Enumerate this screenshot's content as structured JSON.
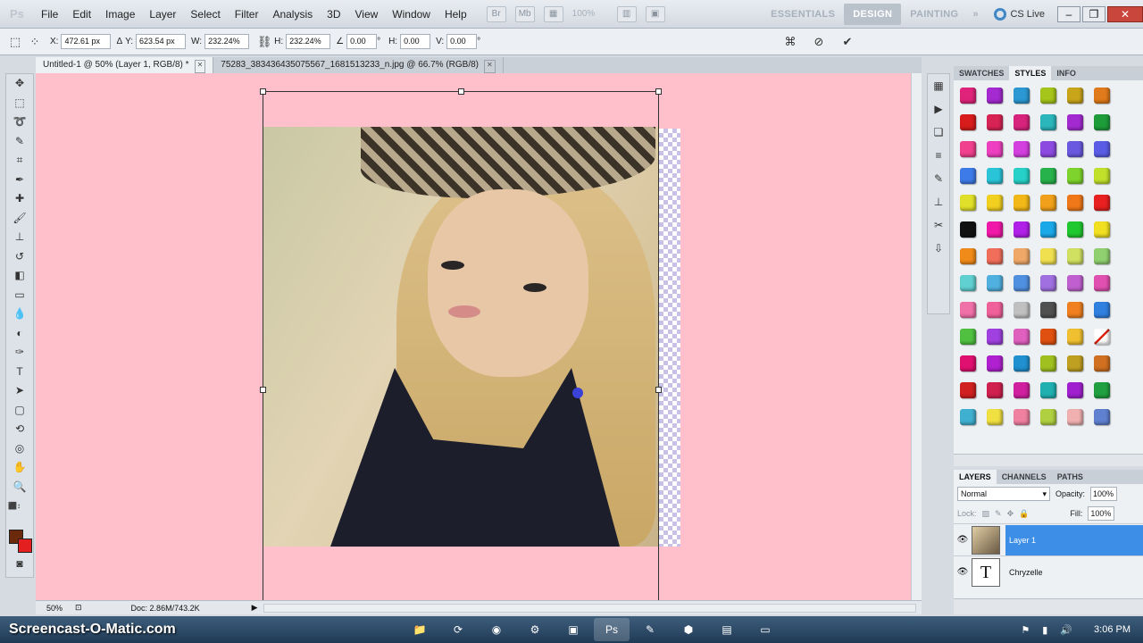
{
  "menubar": {
    "logo": "Ps",
    "items": [
      "File",
      "Edit",
      "Image",
      "Layer",
      "Select",
      "Filter",
      "Analysis",
      "3D",
      "View",
      "Window",
      "Help"
    ],
    "zoom_level": "100%",
    "workspaces": [
      "ESSENTIALS",
      "DESIGN",
      "PAINTING"
    ],
    "workspaces_more": "»",
    "cs_live": "CS Live",
    "window_controls": [
      "–",
      "❐",
      "✕"
    ]
  },
  "options": {
    "x_label": "X:",
    "x_value": "472.61 px",
    "y_label": "Y:",
    "y_value": "623.54 px",
    "w_label": "W:",
    "w_value": "232.24%",
    "h_label": "H:",
    "h_value": "232.24%",
    "angle_value": "0.00",
    "hskew_label": "H:",
    "hskew_value": "0.00",
    "vskew_label": "V:",
    "vskew_value": "0.00",
    "degree": "°"
  },
  "doc_tabs": [
    {
      "label": "Untitled-1 @ 50% (Layer 1, RGB/8) *",
      "close": "✕"
    },
    {
      "label": "75283_383436435075567_1681513233_n.jpg @ 66.7% (RGB/8)",
      "close": "✕"
    }
  ],
  "statusbar": {
    "zoom": "50%",
    "doc": "Doc: 2.86M/743.2K"
  },
  "panels": {
    "styles_tabs": [
      "SWATCHES",
      "STYLES",
      "INFO"
    ],
    "layers_tabs": [
      "LAYERS",
      "CHANNELS",
      "PATHS"
    ],
    "blend_mode": "Normal",
    "opacity_label": "Opacity:",
    "opacity_value": "100%",
    "lock_label": "Lock:",
    "fill_label": "Fill:",
    "fill_value": "100%",
    "layers": [
      {
        "name": "Layer 1",
        "selected": true
      },
      {
        "name": "Chryzelle",
        "selected": false,
        "thumb": "T"
      }
    ]
  },
  "style_colors": [
    "#e0237a",
    "#a52ad1",
    "#2b98d3",
    "#a6c51a",
    "#c9a51a",
    "#e07a1b",
    "#d81c1c",
    "#d82355",
    "#d8237d",
    "#2ab6bb",
    "#a32ad1",
    "#1e9c3a",
    "#f0408e",
    "#ee3fc0",
    "#d43fe0",
    "#8c4ae0",
    "#6b58e0",
    "#5a5ce6",
    "#3d7be8",
    "#29c4d8",
    "#26d1c8",
    "#27b24b",
    "#7ed42c",
    "#c0e02a",
    "#e0e02a",
    "#f2d020",
    "#f2b818",
    "#f0a01a",
    "#f07818",
    "#e82020",
    "#111111",
    "#f018a8",
    "#b020e8",
    "#1aa8e8",
    "#20c830",
    "#f0e020",
    "#f08a18",
    "#f06e5a",
    "#f0a868",
    "#f0e050",
    "#d0e060",
    "#90d070",
    "#60d0d0",
    "#50b0e0",
    "#5090e0",
    "#a070e0",
    "#c060d0",
    "#e050b0",
    "#f070a8",
    "#f0609a",
    "#c0c0c0",
    "#505050",
    "#f08020",
    "#3080e0",
    "#50c040",
    "#a040e0",
    "#e060c0",
    "#e05010",
    "#f0c030",
    "#ffffff",
    "#e01070",
    "#b020d0",
    "#2090d0",
    "#a0c020",
    "#c0a020",
    "#d07020",
    "#d02020",
    "#d02050",
    "#d020a0",
    "#20b0b0",
    "#a020d0",
    "#20a040",
    "#40b0d0",
    "#f0e040",
    "#f080a0",
    "#b0d040",
    "#f0b0b0",
    "#6080d0"
  ],
  "taskbar": {
    "watermark": "Screencast-O-Matic.com",
    "apps": [
      "📁",
      "⟳",
      "◉",
      "⚙",
      "▣",
      "Ps",
      "✎",
      "⬢",
      "▤",
      "▭"
    ],
    "clock": "3:06 PM"
  }
}
